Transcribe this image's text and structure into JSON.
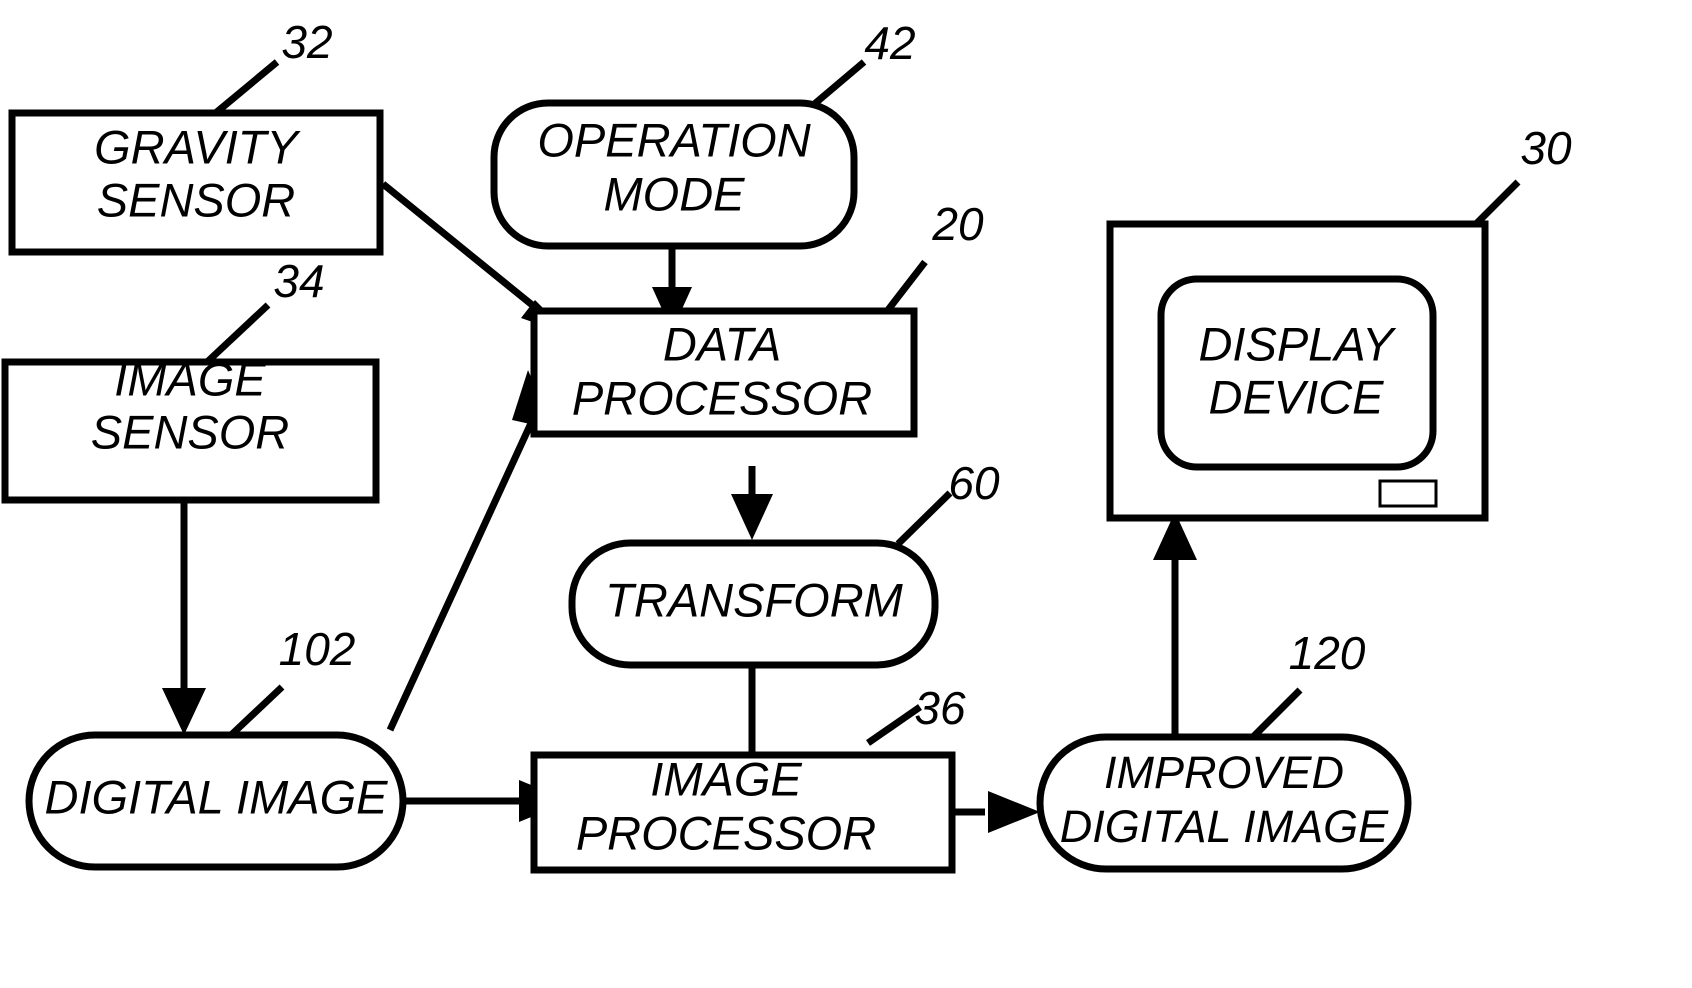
{
  "figure": {
    "title": "System block diagram",
    "background_color": "#ffffff",
    "line_color": "#000000"
  },
  "nodes": {
    "gravity_sensor": {
      "label_line1": "GRAVITY",
      "label_line2": "SENSOR",
      "ref": "32",
      "shape": "rectangle"
    },
    "image_sensor": {
      "label_line1": "IMAGE",
      "label_line2": "SENSOR",
      "ref": "34",
      "shape": "rectangle"
    },
    "operation_mode": {
      "label_line1": "OPERATION",
      "label_line2": "MODE",
      "ref": "42",
      "shape": "stadium"
    },
    "data_processor": {
      "label_line1": "DATA",
      "label_line2": "PROCESSOR",
      "ref": "20",
      "shape": "rectangle"
    },
    "transform": {
      "label_line1": "TRANSFORM",
      "label_line2": "",
      "ref": "60",
      "shape": "stadium"
    },
    "digital_image": {
      "label_line1": "DIGITAL IMAGE",
      "label_line2": "",
      "ref": "102",
      "shape": "stadium"
    },
    "image_processor": {
      "label_line1": "IMAGE",
      "label_line2": "PROCESSOR",
      "ref": "36",
      "shape": "rectangle"
    },
    "improved_digital_image": {
      "label_line1": "IMPROVED",
      "label_line2": "DIGITAL IMAGE",
      "ref": "120",
      "shape": "stadium"
    },
    "display_device": {
      "label_line1": "DISPLAY",
      "label_line2": "DEVICE",
      "ref": "30",
      "shape": "monitor"
    }
  },
  "connections": [
    {
      "name": "gravity-sensor-to-data-processor",
      "from": "gravity_sensor",
      "to": "data_processor"
    },
    {
      "name": "operation-mode-to-data-processor",
      "from": "operation_mode",
      "to": "data_processor"
    },
    {
      "name": "image-sensor-to-digital-image",
      "from": "image_sensor",
      "to": "digital_image"
    },
    {
      "name": "digital-image-to-data-processor",
      "from": "digital_image",
      "to": "data_processor"
    },
    {
      "name": "data-processor-to-transform",
      "from": "data_processor",
      "to": "transform"
    },
    {
      "name": "transform-to-image-processor",
      "from": "transform",
      "to": "image_processor"
    },
    {
      "name": "digital-image-to-image-processor",
      "from": "digital_image",
      "to": "image_processor"
    },
    {
      "name": "image-processor-to-improved-digital-image",
      "from": "image_processor",
      "to": "improved_digital_image"
    },
    {
      "name": "improved-digital-image-to-display-device",
      "from": "improved_digital_image",
      "to": "display_device"
    }
  ]
}
